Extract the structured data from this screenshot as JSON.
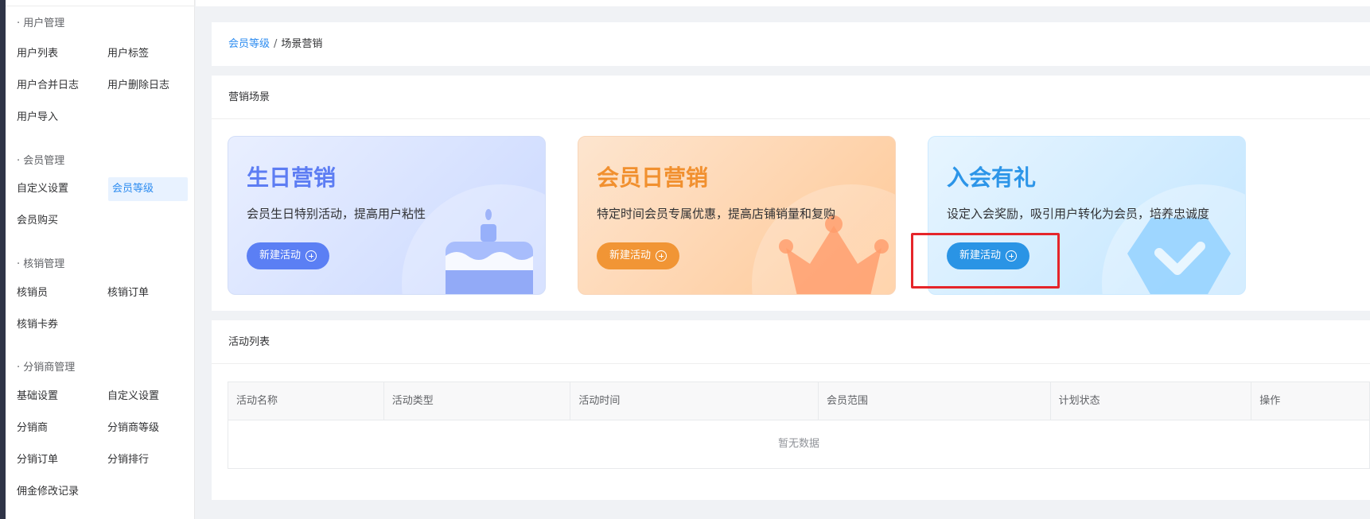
{
  "sidebar": {
    "groups": [
      {
        "title": "· 用户管理",
        "items": [
          "用户列表",
          "用户标签",
          "用户合并日志",
          "用户删除日志",
          "用户导入"
        ]
      },
      {
        "title": "· 会员管理",
        "items": [
          "自定义设置",
          "会员等级",
          "会员购买"
        ]
      },
      {
        "title": "· 核销管理",
        "items": [
          "核销员",
          "核销订单",
          "核销卡券"
        ]
      },
      {
        "title": "· 分销商管理",
        "items": [
          "基础设置",
          "自定义设置",
          "分销商",
          "分销商等级",
          "分销订单",
          "分销排行",
          "佣金修改记录"
        ]
      }
    ],
    "active_item": "会员等级"
  },
  "breadcrumb": {
    "parent": "会员等级",
    "separator": "/",
    "current": "场景营销"
  },
  "scene": {
    "title": "营销场景",
    "cards": [
      {
        "title": "生日营销",
        "desc": "会员生日特别活动，提高用户粘性",
        "button": "新建活动",
        "accent": "#5b7ff4",
        "icon": "cake-icon"
      },
      {
        "title": "会员日营销",
        "desc": "特定时间会员专属优惠，提高店铺销量和复购",
        "button": "新建活动",
        "accent": "#f19535",
        "icon": "crown-icon"
      },
      {
        "title": "入会有礼",
        "desc": "设定入会奖励，吸引用户转化为会员，培养忠诚度",
        "button": "新建活动",
        "accent": "#2a94e5",
        "icon": "badge-check-icon"
      }
    ]
  },
  "activity_list": {
    "title": "活动列表",
    "columns": [
      "活动名称",
      "活动类型",
      "活动时间",
      "会员范围",
      "计划状态",
      "操作"
    ],
    "empty_text": "暂无数据"
  },
  "colors": {
    "link": "#2d8cf0",
    "highlight": "#e5252a",
    "active_bg": "#e8f2ff"
  }
}
